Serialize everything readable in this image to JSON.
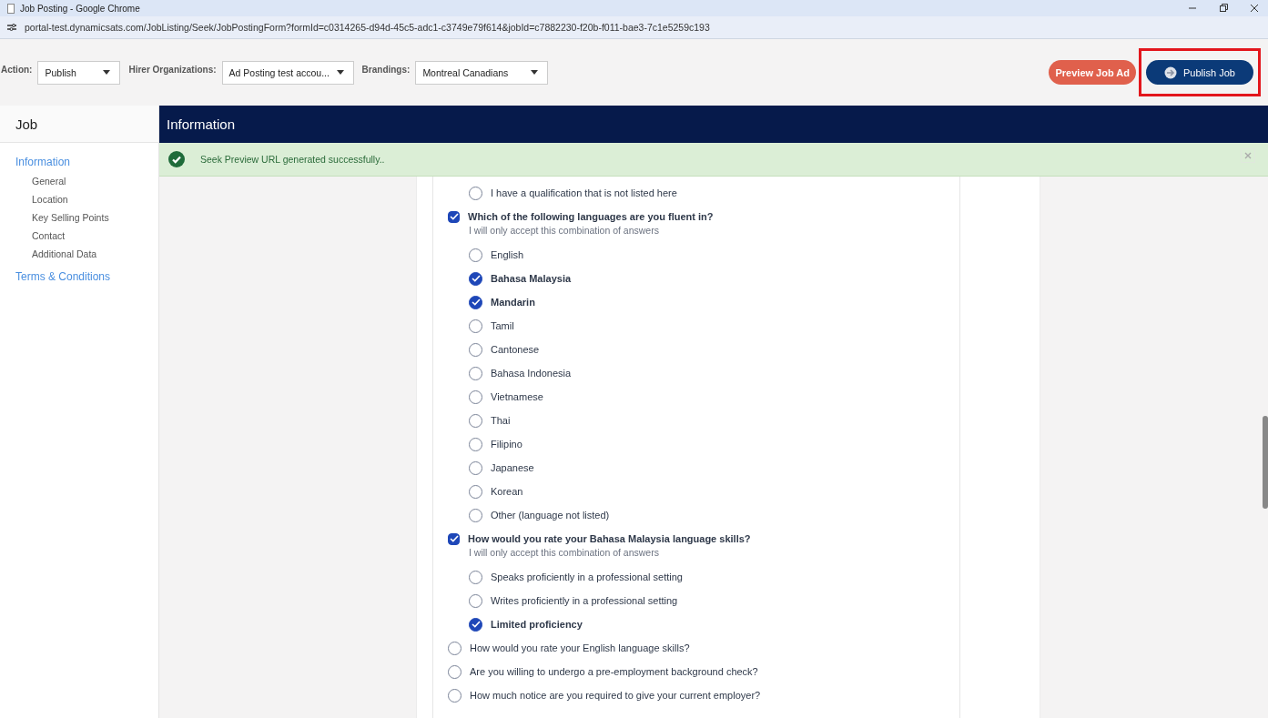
{
  "window": {
    "title": "Job Posting - Google Chrome"
  },
  "address_bar": {
    "url": "portal-test.dynamicsats.com/JobListing/Seek/JobPostingForm?formId=c0314265-d94d-45c5-adc1-c3749e79f614&jobId=c7882230-f20b-f011-bae3-7c1e5259c193"
  },
  "toolbar": {
    "filters": [
      {
        "label": "Action:",
        "value": "Publish"
      },
      {
        "label": "Hirer Organizations:",
        "value": "Ad Posting test accou..."
      },
      {
        "label": "Brandings:",
        "value": "Montreal Canadians"
      }
    ],
    "buttons": [
      {
        "label": "Preview Job Ad",
        "kind": "secondary"
      },
      {
        "label": "Publish Job",
        "kind": "primary"
      }
    ]
  },
  "sidebar": {
    "title": "Job",
    "sections": [
      {
        "label": "Information",
        "children": [
          {
            "label": "General"
          },
          {
            "label": "Location"
          },
          {
            "label": "Key Selling Points"
          },
          {
            "label": "Contact"
          },
          {
            "label": "Additional Data"
          }
        ]
      },
      {
        "label": "Terms & Conditions"
      }
    ]
  },
  "panel": {
    "title": "Information"
  },
  "alert": {
    "message": "Seek Preview URL generated successfully.."
  },
  "questions": [
    {
      "options": [
        {
          "label": "I have a qualification that is not listed here",
          "checked": false
        }
      ]
    },
    {
      "text": "Which of the following languages are you fluent in?",
      "checked": true,
      "hint": "I will only accept this combination of answers",
      "options": [
        {
          "label": "English",
          "checked": false
        },
        {
          "label": "Bahasa Malaysia",
          "checked": true
        },
        {
          "label": "Mandarin",
          "checked": true
        },
        {
          "label": "Tamil",
          "checked": false
        },
        {
          "label": "Cantonese",
          "checked": false
        },
        {
          "label": "Bahasa Indonesia",
          "checked": false
        },
        {
          "label": "Vietnamese",
          "checked": false
        },
        {
          "label": "Thai",
          "checked": false
        },
        {
          "label": "Filipino",
          "checked": false
        },
        {
          "label": "Japanese",
          "checked": false
        },
        {
          "label": "Korean",
          "checked": false
        },
        {
          "label": "Other (language not listed)",
          "checked": false
        }
      ]
    },
    {
      "text": "How would you rate your Bahasa Malaysia language skills?",
      "checked": true,
      "hint": "I will only accept this combination of answers",
      "options": [
        {
          "label": "Speaks proficiently in a professional setting",
          "checked": false
        },
        {
          "label": "Writes proficiently in a professional setting",
          "checked": false
        },
        {
          "label": "Limited proficiency",
          "checked": true
        }
      ]
    },
    {
      "text": "How would you rate your English language skills?",
      "checked": false
    },
    {
      "text": "Are you willing to undergo a pre-employment background check?",
      "checked": false
    },
    {
      "text": "How much notice are you required to give your current employer?",
      "checked": false
    }
  ]
}
